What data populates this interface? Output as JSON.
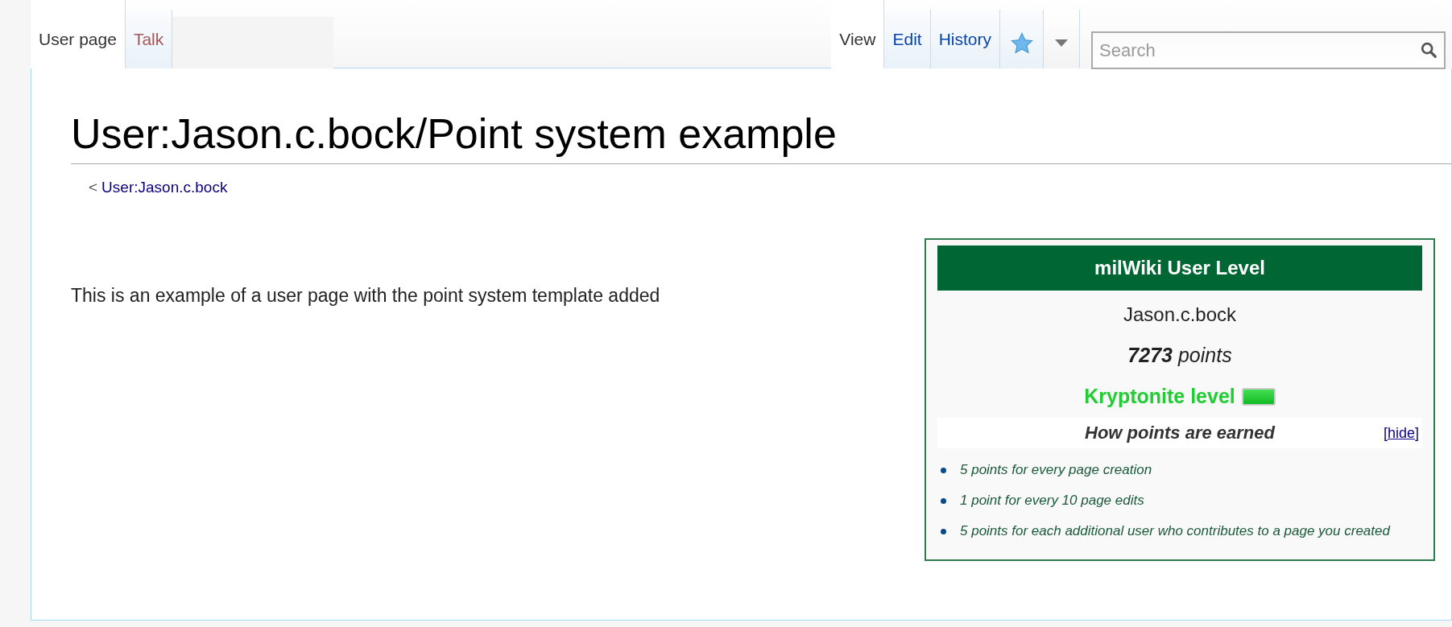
{
  "left_tabs": [
    {
      "label": "User page",
      "selected": true,
      "missing": false
    },
    {
      "label": "Talk",
      "selected": false,
      "missing": true
    }
  ],
  "right_tabs": [
    {
      "label": "View",
      "selected": true
    },
    {
      "label": "Edit",
      "selected": false
    },
    {
      "label": "History",
      "selected": false
    }
  ],
  "search": {
    "placeholder": "Search"
  },
  "title": "User:Jason.c.bock/Point system example",
  "breadcrumb": {
    "prefix": "<",
    "link": "User:Jason.c.bock"
  },
  "paragraph": "This is an example of a user page with the point system template added",
  "infobox": {
    "header": "milWiki User Level",
    "user": "Jason.c.bock",
    "points": "**7273** points",
    "level": "Kryptonite level",
    "section": {
      "title": "How points are earned",
      "toggle": "[hide]"
    },
    "items": [
      "5 points for every page creation",
      "1 point for every 10 page edits",
      "5 points for each additional user who contributes to a page you created"
    ]
  }
}
